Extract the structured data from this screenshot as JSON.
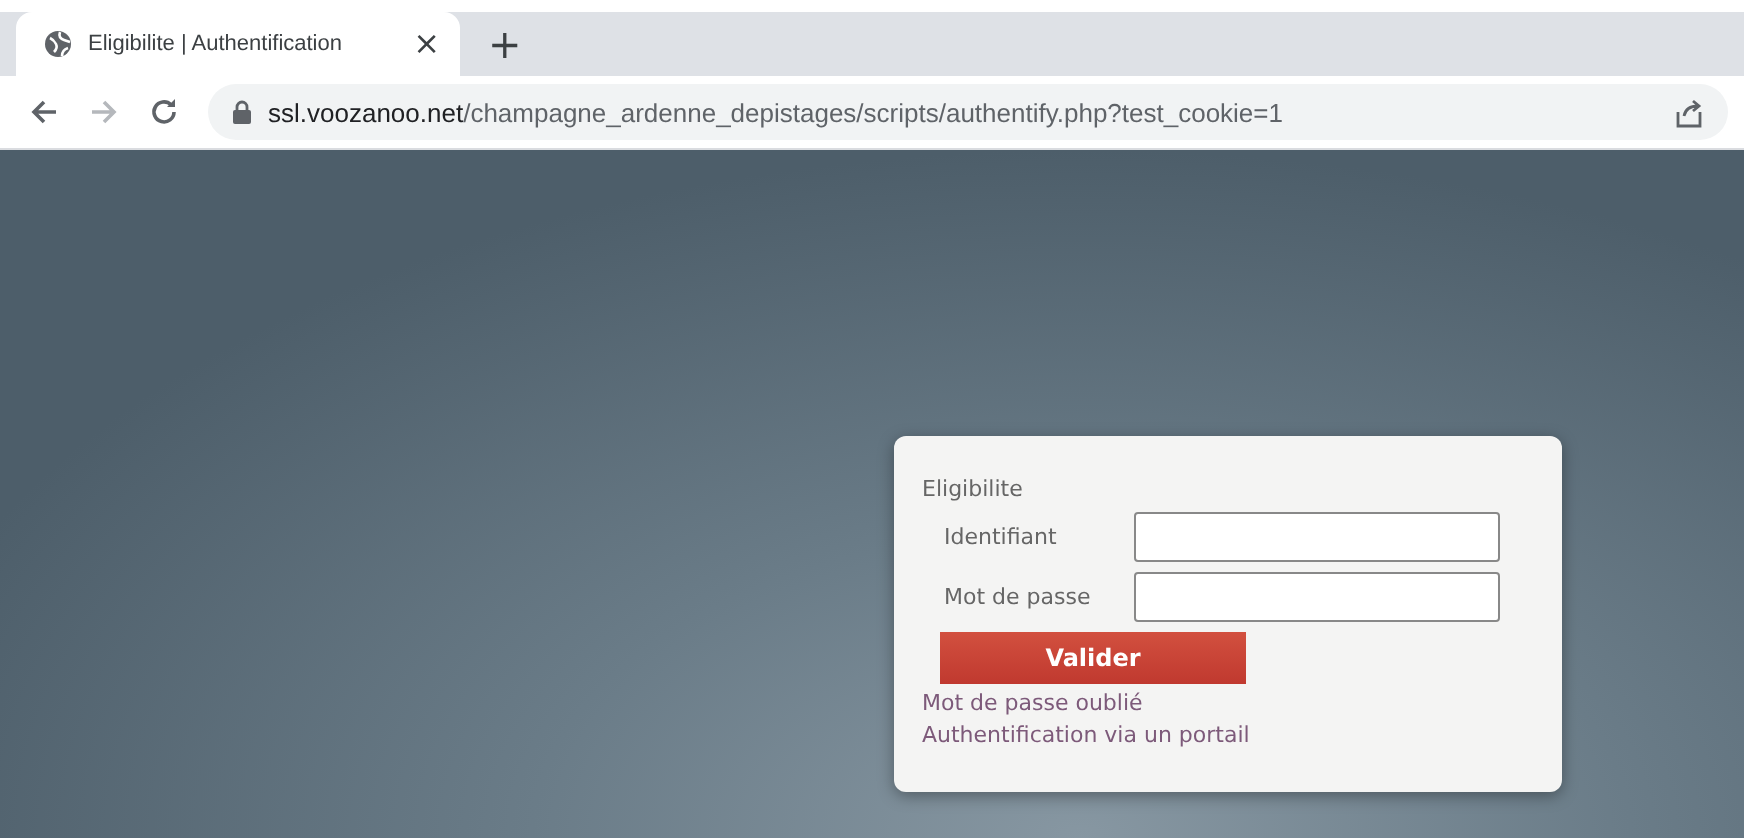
{
  "browser": {
    "tabs": [
      {
        "title": "Eligibilite | Authentification",
        "selected": true,
        "close": "×"
      }
    ],
    "new_tab": "+",
    "url_host": "ssl.voozanoo.net",
    "url_path": "/champagne_ardenne_depistages/scripts/authentify.php?test_cookie=1"
  },
  "login": {
    "title": "Eligibilite",
    "fields": [
      {
        "label": "Identifiant"
      },
      {
        "label": "Mot de passe"
      }
    ],
    "submit": "Valider",
    "links": [
      "Mot de passe oublié",
      "Authentification via un portail"
    ]
  }
}
